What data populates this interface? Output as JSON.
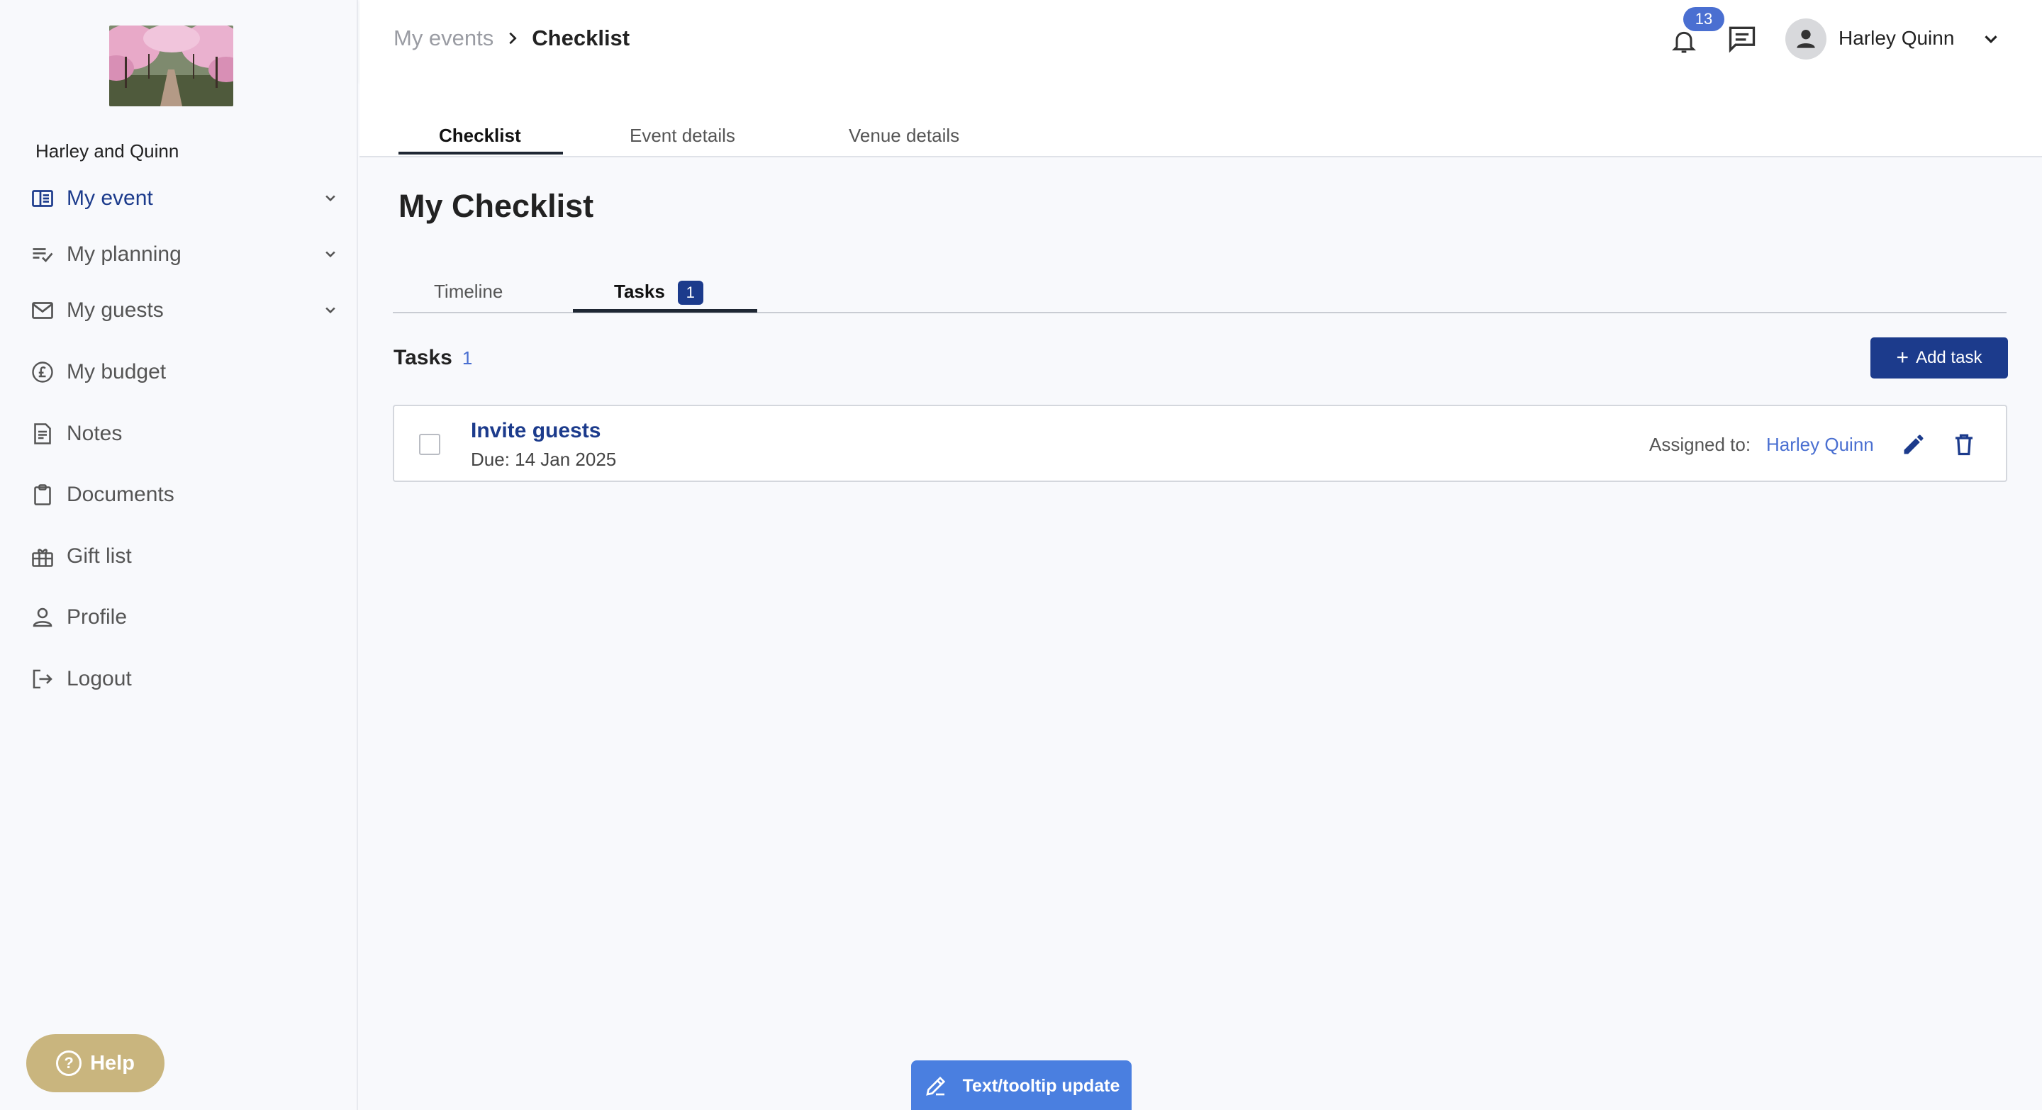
{
  "sidebar": {
    "event_name": "Harley and Quinn",
    "items": [
      {
        "label": "My event",
        "icon": "event-book-icon",
        "expandable": true,
        "active": true
      },
      {
        "label": "My planning",
        "icon": "planning-list-icon",
        "expandable": true,
        "active": false
      },
      {
        "label": "My guests",
        "icon": "mail-icon",
        "expandable": true,
        "active": false
      },
      {
        "label": "My budget",
        "icon": "pound-circle-icon",
        "expandable": false,
        "active": false
      },
      {
        "label": "Notes",
        "icon": "notes-icon",
        "expandable": false,
        "active": false
      },
      {
        "label": "Documents",
        "icon": "clipboard-icon",
        "expandable": false,
        "active": false
      },
      {
        "label": "Gift list",
        "icon": "gift-icon",
        "expandable": false,
        "active": false
      },
      {
        "label": "Profile",
        "icon": "person-icon",
        "expandable": false,
        "active": false
      },
      {
        "label": "Logout",
        "icon": "logout-icon",
        "expandable": false,
        "active": false
      }
    ],
    "help_label": "Help"
  },
  "header": {
    "breadcrumb_root": "My events",
    "breadcrumb_current": "Checklist",
    "notification_count": "13",
    "user_name": "Harley Quinn"
  },
  "main_tabs": {
    "checklist": "Checklist",
    "event_details": "Event details",
    "venue_details": "Venue details",
    "active": "Checklist"
  },
  "page": {
    "title": "My Checklist",
    "sub_tabs": {
      "timeline": "Timeline",
      "tasks": "Tasks",
      "tasks_count": "1",
      "active": "Tasks"
    },
    "section_title": "Tasks",
    "section_count": "1",
    "add_task_label": "Add task"
  },
  "tasks": [
    {
      "title": "Invite guests",
      "due": "Due: 14 Jan 2025",
      "assigned_label": "Assigned to:",
      "assigned_to": "Harley Quinn",
      "completed": false
    }
  ],
  "feedback": {
    "label": "Text/tooltip update"
  },
  "colors": {
    "brand": "#1c3b8c",
    "accent": "#4a6fd1",
    "help": "#c9b57e",
    "feedback": "#4a7fe0"
  }
}
